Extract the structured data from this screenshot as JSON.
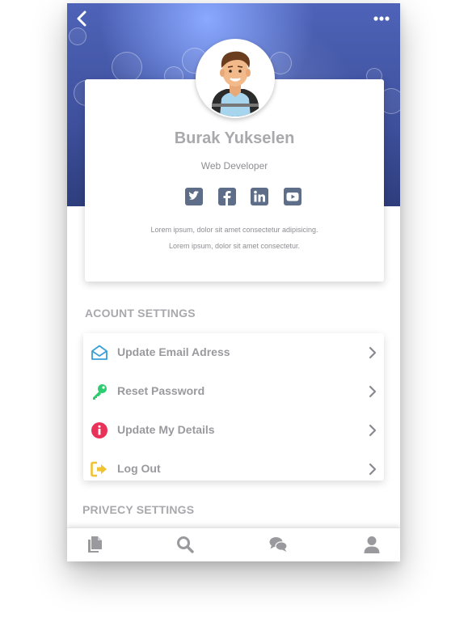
{
  "profile": {
    "name": "Burak Yukselen",
    "role": "Web Developer",
    "bio_line1": "Lorem ipsum, dolor sit amet consectetur adipisicing.",
    "bio_line2": "Lorem ipsum, dolor sit amet consectetur."
  },
  "social": [
    "twitter-icon",
    "facebook-icon",
    "linkedin-icon",
    "youtube-icon"
  ],
  "account_settings": {
    "title": "ACOUNT SETTINGS",
    "items": [
      {
        "label": "Update Email Adress",
        "icon": "envelope-open-icon",
        "color": "#3a9fd8"
      },
      {
        "label": "Reset Password",
        "icon": "key-icon",
        "color": "#2ecc71"
      },
      {
        "label": "Update My Details",
        "icon": "info-icon",
        "color": "#e8325a"
      },
      {
        "label": "Log Out",
        "icon": "sign-out-icon",
        "color": "#f1c232"
      }
    ]
  },
  "privacy_settings": {
    "title": "PRIVECY SETTINGS"
  },
  "tabbar": [
    "documents-icon",
    "search-icon",
    "chat-icon",
    "user-icon"
  ],
  "colors": {
    "accent_social": "#5e6e88",
    "text_muted": "#a9a9ad"
  }
}
